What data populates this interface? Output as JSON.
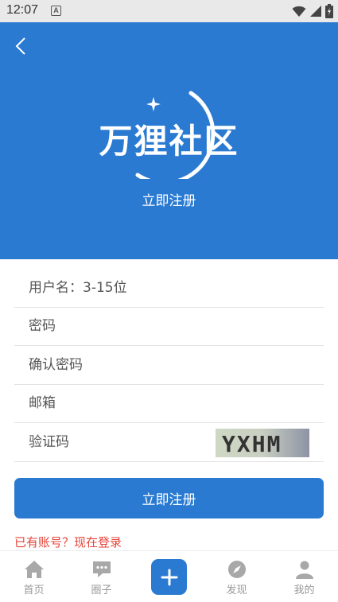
{
  "status_bar": {
    "time": "12:07",
    "notification_icon": "A"
  },
  "header": {
    "logo_text": "万狸社区",
    "subtitle": "立即注册"
  },
  "form": {
    "username_placeholder": "用户名：3-15位",
    "password_placeholder": "密码",
    "confirm_password_placeholder": "确认密码",
    "email_placeholder": "邮箱",
    "captcha_placeholder": "验证码",
    "captcha_text": "YXHM"
  },
  "actions": {
    "submit_label": "立即注册",
    "login_link": "已有账号？现在登录"
  },
  "tabbar": {
    "items": [
      {
        "label": "首页",
        "icon": "home-icon"
      },
      {
        "label": "圈子",
        "icon": "chat-icon"
      },
      {
        "label": "",
        "icon": "plus-icon"
      },
      {
        "label": "发现",
        "icon": "compass-icon"
      },
      {
        "label": "我的",
        "icon": "user-icon"
      }
    ]
  },
  "colors": {
    "primary": "#2a7ad2",
    "link": "#e6463a",
    "tab_inactive": "#9a9a9a"
  }
}
